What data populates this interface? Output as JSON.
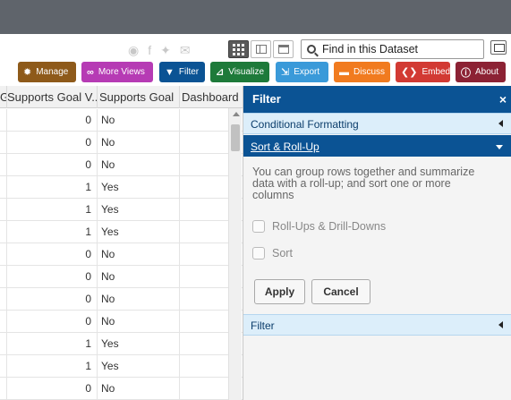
{
  "toolbar": {
    "manage": {
      "label": "Manage",
      "color": "#8e5a1a"
    },
    "more_views": {
      "label": "More Views",
      "color": "#b63bb4"
    },
    "filter": {
      "label": "Filter",
      "color": "#0b5394"
    },
    "visualize": {
      "label": "Visualize",
      "color": "#1e7a3a"
    },
    "export": {
      "label": "Export",
      "color": "#3a9ad9"
    },
    "discuss": {
      "label": "Discuss",
      "color": "#f17b1f"
    },
    "embed": {
      "label": "Embed",
      "color": "#d23a33"
    },
    "about": {
      "label": "About",
      "color": "#8c2234"
    }
  },
  "search": {
    "placeholder": "Find in this Dataset"
  },
  "social_icons": [
    "rss-icon",
    "facebook-icon",
    "twitter-icon",
    "email-icon"
  ],
  "view_switcher": [
    "grid-view-icon",
    "cards-view-icon",
    "page-view-icon"
  ],
  "table": {
    "headers": [
      "G",
      "Supports Goal V...",
      "Supports Goal",
      "Dashboard"
    ],
    "rows": [
      [
        "0",
        "No"
      ],
      [
        "0",
        "No"
      ],
      [
        "0",
        "No"
      ],
      [
        "1",
        "Yes"
      ],
      [
        "1",
        "Yes"
      ],
      [
        "1",
        "Yes"
      ],
      [
        "0",
        "No"
      ],
      [
        "0",
        "No"
      ],
      [
        "0",
        "No"
      ],
      [
        "0",
        "No"
      ],
      [
        "1",
        "Yes"
      ],
      [
        "1",
        "Yes"
      ],
      [
        "0",
        "No"
      ]
    ]
  },
  "panel": {
    "title": "Filter",
    "close": "×",
    "sections": {
      "conditional": "Conditional Formatting",
      "sort": "Sort & Roll-Up",
      "filter": "Filter"
    },
    "description": "You can group rows together and summarize data with a roll-up; and sort one or more columns",
    "checkboxes": {
      "rollups": "Roll-Ups & Drill-Downs",
      "sort": "Sort"
    },
    "apply": "Apply",
    "cancel": "Cancel"
  }
}
